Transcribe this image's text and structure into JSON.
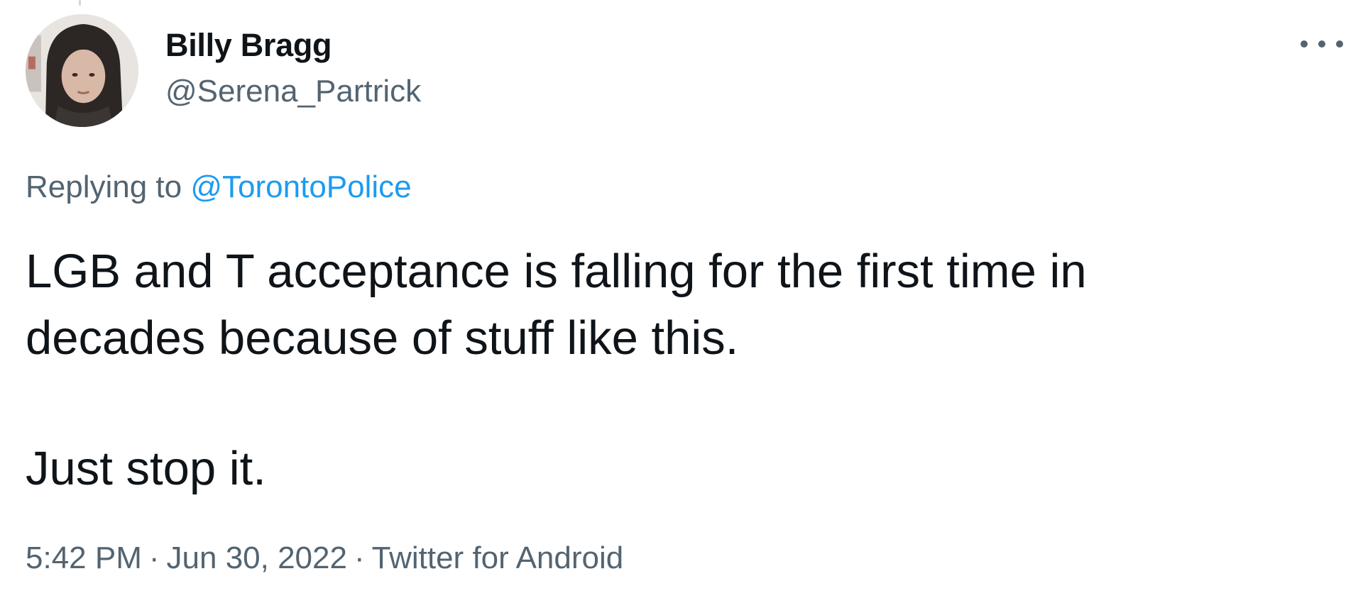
{
  "author": {
    "display_name": "Billy Bragg",
    "handle": "@Serena_Partrick",
    "avatar": "profile-photo-avatar"
  },
  "reply": {
    "prefix": "Replying to ",
    "mention": "@TorontoPolice"
  },
  "tweet": {
    "line1": "LGB and T acceptance is falling for the first time in",
    "line2": "decades because of stuff like this.",
    "line3": "Just stop it."
  },
  "meta": {
    "time": "5:42 PM",
    "separator": "·",
    "date": "Jun 30, 2022",
    "source": "Twitter for Android"
  },
  "icons": {
    "more": "more-options-icon"
  },
  "colors": {
    "text": "#0f1419",
    "secondary": "#536471",
    "link": "#1d9bf0",
    "background": "#ffffff"
  }
}
